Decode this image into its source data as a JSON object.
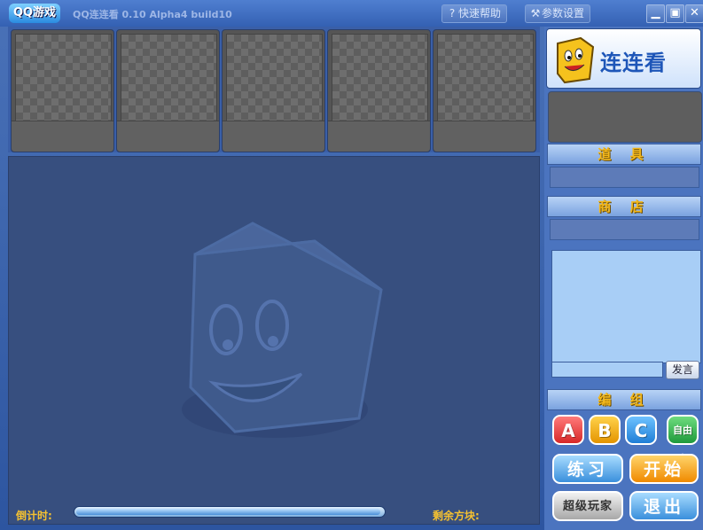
{
  "titlebar": {
    "logo_text": "QQ游戏",
    "app_title": "QQ连连看 0.10 Alpha4 build10",
    "help_label": "快速帮助",
    "settings_label": "参数设置",
    "help_icon": "question-icon",
    "settings_icon": "wrench-icon",
    "minimize_glyph": "▁",
    "maximize_glyph": "▣",
    "close_glyph": "✕"
  },
  "slots": [
    {},
    {},
    {},
    {},
    {}
  ],
  "board": {
    "countdown_label": "倒计时:",
    "remaining_label": "剩余方块:",
    "timer_progress": 0.99
  },
  "sidebar": {
    "brand_text": "连连看",
    "items_label": "道 具",
    "shop_label": "商 店",
    "chat_input_value": "",
    "send_label": "发言",
    "group_label": "编 组",
    "groups": [
      "A",
      "B",
      "C",
      "自由人"
    ],
    "group_colors": [
      "#e23a3a",
      "#f0a010",
      "#2e8fe0",
      "#2aa84a"
    ],
    "practice_label": "练习",
    "start_label": "开始",
    "super_player_label": "超级玩家",
    "exit_label": "退出"
  },
  "colors": {
    "label_gold": "#f6c230",
    "board_bg": "#374f7f"
  }
}
